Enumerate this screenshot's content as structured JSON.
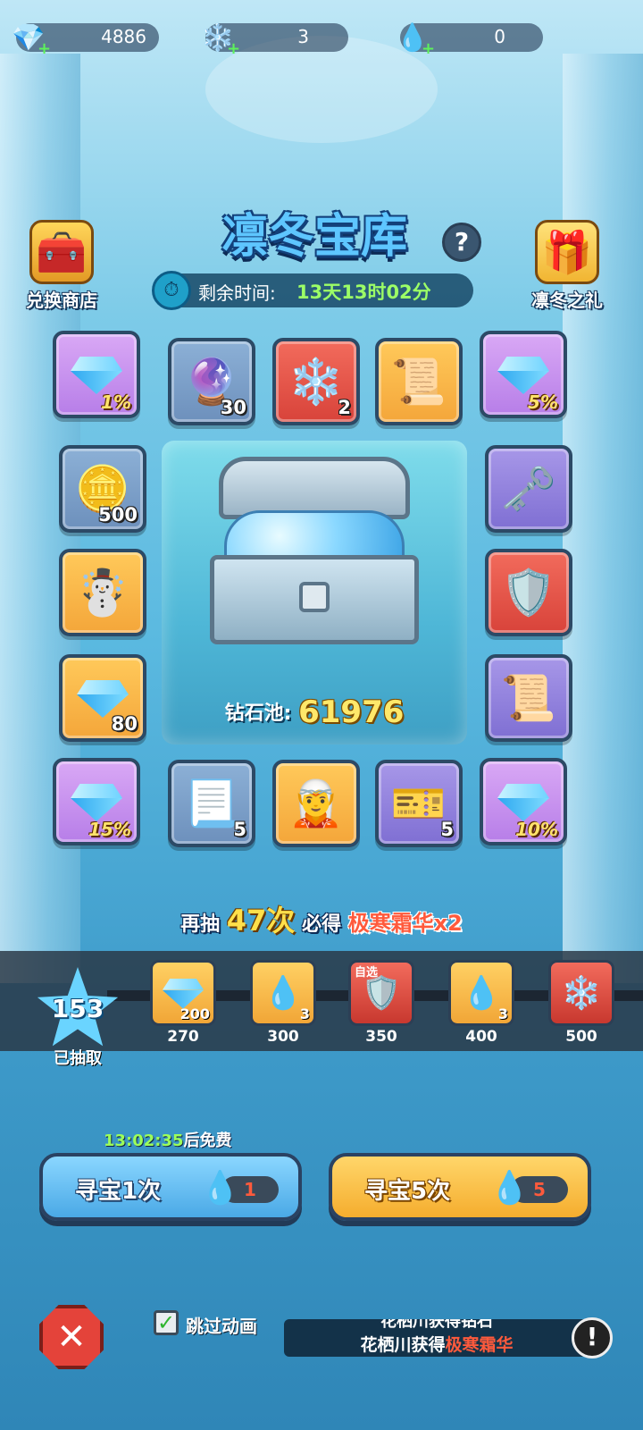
{
  "currencies": [
    {
      "icon": "diamond-icon",
      "value": "4886"
    },
    {
      "icon": "snowflake-icon",
      "value": "3"
    },
    {
      "icon": "water-drop-icon",
      "value": "0"
    }
  ],
  "title": "凛冬宝库",
  "help_label": "?",
  "timer": {
    "label": "剩余时间:",
    "value": "13天13时02分"
  },
  "left_button": {
    "label": "兑换商店",
    "icon": "treasure-chest-icon"
  },
  "right_button": {
    "label": "凛冬之礼",
    "icon": "gift-box-icon"
  },
  "tiles": [
    {
      "icon": "diamond-icon",
      "pct": "1%",
      "qty": ""
    },
    {
      "icon": "mystery-orb-icon",
      "pct": "",
      "qty": "30"
    },
    {
      "icon": "snowflake-icon",
      "pct": "",
      "qty": "2"
    },
    {
      "icon": "red-scroll-icon",
      "pct": "",
      "qty": ""
    },
    {
      "icon": "diamond-icon",
      "pct": "5%",
      "qty": ""
    },
    {
      "icon": "gold-coin-icon",
      "pct": "",
      "qty": "500"
    },
    {
      "icon": "key-icon",
      "pct": "",
      "qty": ""
    },
    {
      "icon": "snow-spirit-icon",
      "pct": "",
      "qty": ""
    },
    {
      "icon": "hero-selection-icon",
      "pct": "",
      "qty": ""
    },
    {
      "icon": "diamond-icon",
      "pct": "",
      "qty": "80"
    },
    {
      "icon": "purple-scroll-icon",
      "pct": "",
      "qty": ""
    },
    {
      "icon": "diamond-icon",
      "pct": "15%",
      "qty": ""
    },
    {
      "icon": "mystery-scroll-icon",
      "pct": "",
      "qty": "5"
    },
    {
      "icon": "ice-queen-icon",
      "pct": "",
      "qty": ""
    },
    {
      "icon": "golden-ticket-icon",
      "pct": "",
      "qty": "5"
    },
    {
      "icon": "diamond-icon",
      "pct": "10%",
      "qty": ""
    }
  ],
  "pool": {
    "label": "钻石池:",
    "value": "61976"
  },
  "guarantee": {
    "prefix": "再抽",
    "count": "47次",
    "mid": "必得",
    "item": "极寒霜华x2"
  },
  "progress": {
    "drawn": "153",
    "drawn_label": "已抽取",
    "milestones": [
      {
        "icon": "diamond-icon",
        "qty": "200",
        "label": "270"
      },
      {
        "icon": "water-drop-icon",
        "qty": "3",
        "label": "300"
      },
      {
        "icon": "hero-selection-icon",
        "qty": "",
        "label": "350",
        "tag": "自选"
      },
      {
        "icon": "water-drop-icon",
        "qty": "3",
        "label": "400"
      },
      {
        "icon": "snowflake-icon",
        "qty": "",
        "label": "500"
      }
    ]
  },
  "free_timer": {
    "time": "13:02:35",
    "suffix": "后免费"
  },
  "draw1": {
    "label": "寻宝1次",
    "cost": "1"
  },
  "draw5": {
    "label": "寻宝5次",
    "cost": "5"
  },
  "skip_animation": {
    "label": "跳过动画",
    "checked": true
  },
  "ticker": {
    "line1": "花栖川获得钻石",
    "line2_name": "花栖川获得",
    "line2_item": "极寒霜华"
  },
  "colors": {
    "accent_blue": "#5ec6ff",
    "gold": "#ffe04a",
    "red": "#ff5a3c",
    "green": "#9cff66"
  }
}
